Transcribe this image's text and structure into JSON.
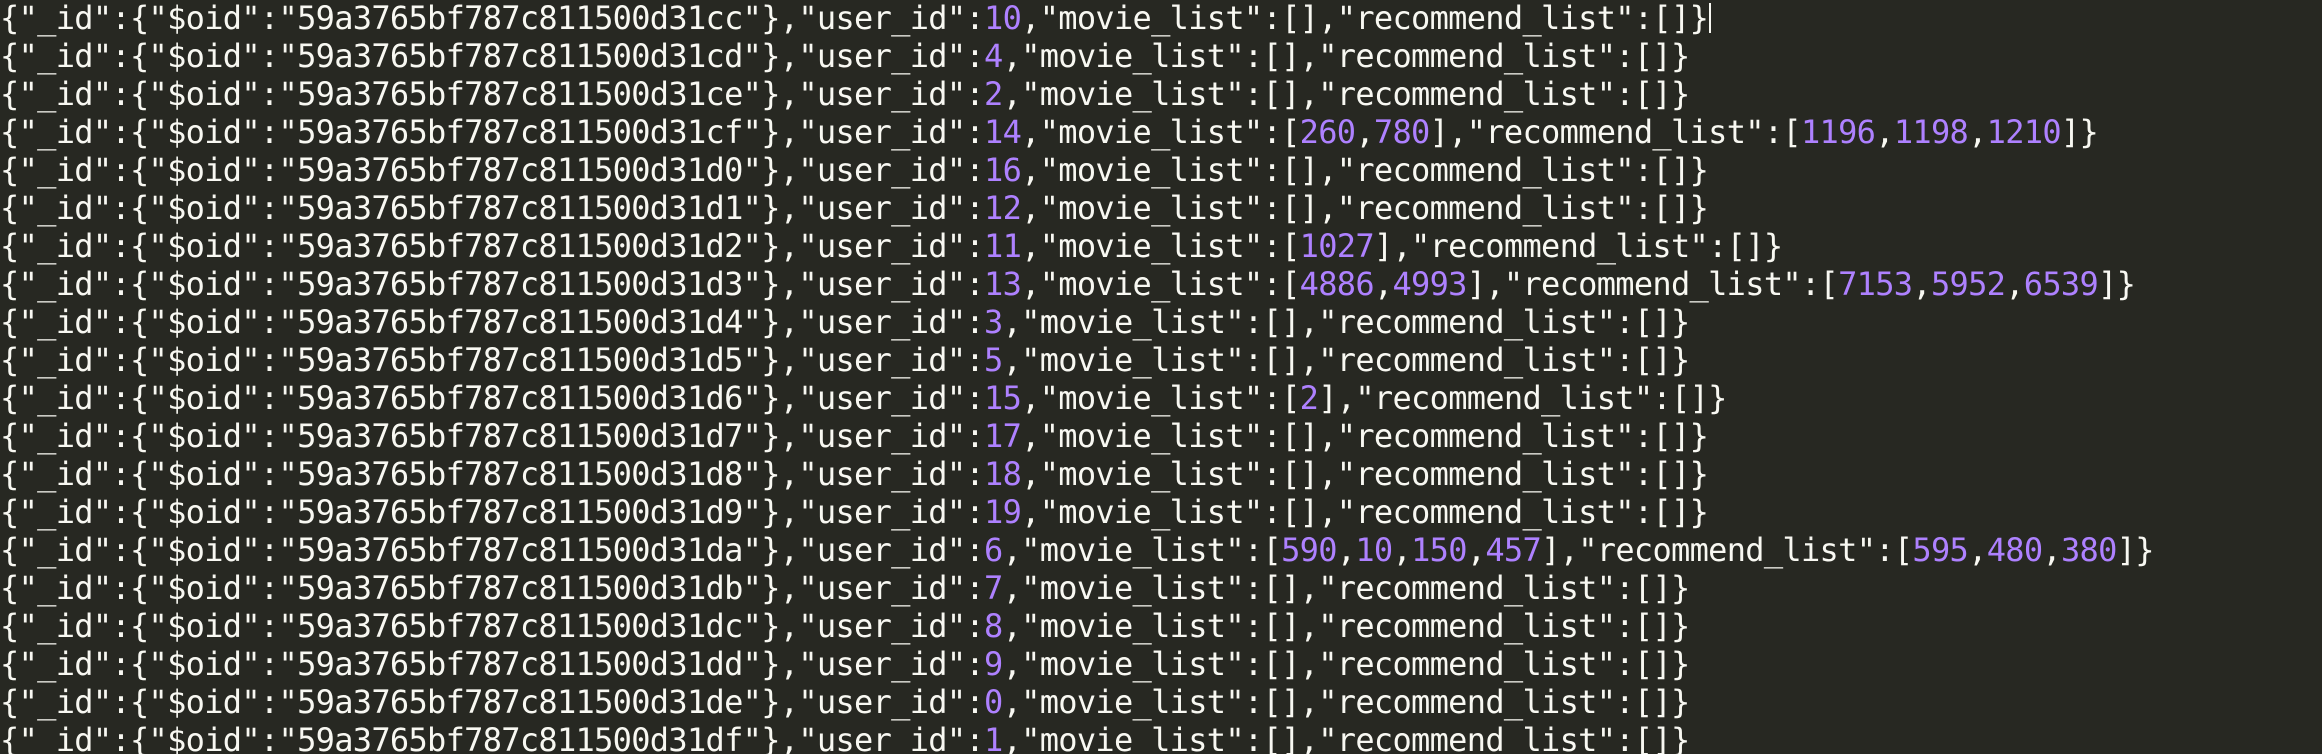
{
  "theme": {
    "background": "#272822",
    "text_color": "#f8f8f2",
    "number_color": "#ae81ff"
  },
  "lines": [
    {
      "oid": "59a3765bf787c811500d31cc",
      "user_id": "10",
      "movie_list": [],
      "recommend_list": []
    },
    {
      "oid": "59a3765bf787c811500d31cd",
      "user_id": "4",
      "movie_list": [],
      "recommend_list": []
    },
    {
      "oid": "59a3765bf787c811500d31ce",
      "user_id": "2",
      "movie_list": [],
      "recommend_list": []
    },
    {
      "oid": "59a3765bf787c811500d31cf",
      "user_id": "14",
      "movie_list": [
        "260",
        "780"
      ],
      "recommend_list": [
        "1196",
        "1198",
        "1210"
      ]
    },
    {
      "oid": "59a3765bf787c811500d31d0",
      "user_id": "16",
      "movie_list": [],
      "recommend_list": []
    },
    {
      "oid": "59a3765bf787c811500d31d1",
      "user_id": "12",
      "movie_list": [],
      "recommend_list": []
    },
    {
      "oid": "59a3765bf787c811500d31d2",
      "user_id": "11",
      "movie_list": [
        "1027"
      ],
      "recommend_list": []
    },
    {
      "oid": "59a3765bf787c811500d31d3",
      "user_id": "13",
      "movie_list": [
        "4886",
        "4993"
      ],
      "recommend_list": [
        "7153",
        "5952",
        "6539"
      ]
    },
    {
      "oid": "59a3765bf787c811500d31d4",
      "user_id": "3",
      "movie_list": [],
      "recommend_list": []
    },
    {
      "oid": "59a3765bf787c811500d31d5",
      "user_id": "5",
      "movie_list": [],
      "recommend_list": []
    },
    {
      "oid": "59a3765bf787c811500d31d6",
      "user_id": "15",
      "movie_list": [
        "2"
      ],
      "recommend_list": []
    },
    {
      "oid": "59a3765bf787c811500d31d7",
      "user_id": "17",
      "movie_list": [],
      "recommend_list": []
    },
    {
      "oid": "59a3765bf787c811500d31d8",
      "user_id": "18",
      "movie_list": [],
      "recommend_list": []
    },
    {
      "oid": "59a3765bf787c811500d31d9",
      "user_id": "19",
      "movie_list": [],
      "recommend_list": []
    },
    {
      "oid": "59a3765bf787c811500d31da",
      "user_id": "6",
      "movie_list": [
        "590",
        "10",
        "150",
        "457"
      ],
      "recommend_list": [
        "595",
        "480",
        "380"
      ]
    },
    {
      "oid": "59a3765bf787c811500d31db",
      "user_id": "7",
      "movie_list": [],
      "recommend_list": []
    },
    {
      "oid": "59a3765bf787c811500d31dc",
      "user_id": "8",
      "movie_list": [],
      "recommend_list": []
    },
    {
      "oid": "59a3765bf787c811500d31dd",
      "user_id": "9",
      "movie_list": [],
      "recommend_list": []
    },
    {
      "oid": "59a3765bf787c811500d31de",
      "user_id": "0",
      "movie_list": [],
      "recommend_list": []
    },
    {
      "oid": "59a3765bf787c811500d31df",
      "user_id": "1",
      "movie_list": [],
      "recommend_list": []
    }
  ]
}
